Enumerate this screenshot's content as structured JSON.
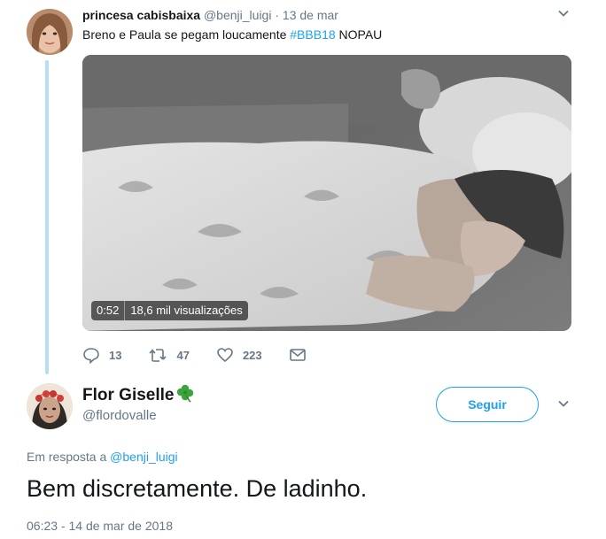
{
  "original_tweet": {
    "display_name": "princesa cabisbaixa",
    "handle": "@benji_luigi",
    "separator": " · ",
    "date": "13 de mar",
    "text_before": "Breno e Paula se pegam loucamente ",
    "hashtag": "#BBB18",
    "text_after": " NOPAU",
    "video": {
      "duration": "0:52",
      "views": "18,6 mil visualizações"
    },
    "actions": {
      "replies": "13",
      "retweets": "47",
      "likes": "223"
    }
  },
  "reply_tweet": {
    "display_name": "Flor Giselle",
    "name_emoji": "🍀",
    "handle": "@flordovalle",
    "follow_label": "Seguir",
    "reply_prefix": "Em resposta a ",
    "reply_mention": "@benji_luigi",
    "text": "Bem discretamente. De ladinho.",
    "timestamp": "06:23 - 14 de mar de 2018"
  },
  "colors": {
    "accent": "#1da1f2",
    "thread_line": "#b3def6",
    "secondary_text": "#657786"
  },
  "icons": [
    "chevron-down-icon",
    "reply-icon",
    "retweet-icon",
    "like-icon",
    "dm-icon",
    "clover-emoji"
  ]
}
